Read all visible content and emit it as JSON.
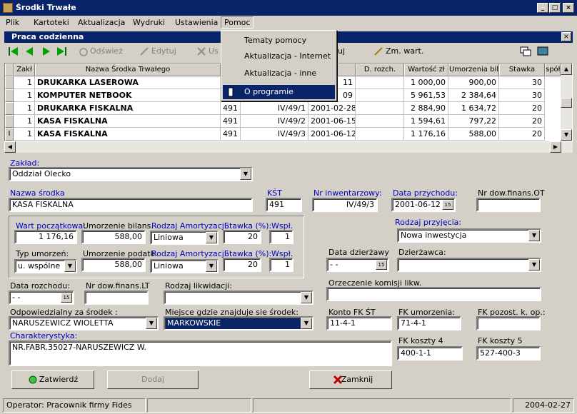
{
  "window": {
    "title": "Środki Trwałe",
    "min": "_",
    "max": "□",
    "close": "×"
  },
  "menu": [
    {
      "label": "Plik"
    },
    {
      "label": "Kartoteki"
    },
    {
      "label": "Aktualizacja"
    },
    {
      "label": "Wydruki"
    },
    {
      "label": "Ustawienia"
    },
    {
      "label": "Pomoc"
    }
  ],
  "dropdown": {
    "items": [
      {
        "label": "Tematy pomocy"
      },
      {
        "label": "Aktualizacja  - Internet"
      },
      {
        "label": "Aktualizacja  - inne"
      },
      {
        "label": "O programie"
      }
    ]
  },
  "inner": {
    "title": "Praca codzienna",
    "close": "×"
  },
  "toolbar": {
    "refresh": "Odśwież",
    "edit": "Edytuj",
    "delete": "Us",
    "hidden_fragment": "uj",
    "change_value": "Zm. wart."
  },
  "grid": {
    "headers": [
      "Zakł",
      "Nazwa Środka Trwałego",
      "",
      "",
      "ch.",
      "D. rozch.",
      "Wartość zł",
      "Umorzenia bil.",
      "Stawka",
      "spół"
    ],
    "rows": [
      {
        "zakl": "1",
        "name": "DRUKARKA LASEROWA",
        "kst": "",
        "inv": "",
        "date": "11",
        "rozch": "",
        "value": "1 000,00",
        "umorz": "900,00",
        "stawka": "30"
      },
      {
        "zakl": "1",
        "name": "KOMPUTER NETBOOK",
        "kst": "",
        "inv": "",
        "date": "09",
        "rozch": "",
        "value": "5 961,53",
        "umorz": "2 384,64",
        "stawka": "30"
      },
      {
        "zakl": "1",
        "name": "DRUKARKA FISKALNA",
        "kst": "491",
        "inv": "IV/49/1",
        "date": "2001-02-28",
        "rozch": "",
        "value": "2 884,90",
        "umorz": "1 634,72",
        "stawka": "20"
      },
      {
        "zakl": "1",
        "name": "KASA FISKALNA",
        "kst": "491",
        "inv": "IV/49/2",
        "date": "2001-06-15",
        "rozch": "",
        "value": "1 594,61",
        "umorz": "797,22",
        "stawka": "20"
      },
      {
        "zakl": "1",
        "name": "KASA FISKALNA",
        "kst": "491",
        "inv": "IV/49/3",
        "date": "2001-06-12",
        "rozch": "",
        "value": "1 176,16",
        "umorz": "588,00",
        "stawka": "20"
      }
    ],
    "current_marker": "I"
  },
  "form": {
    "zaklad_label": "Zakład:",
    "zaklad_value": "Oddział Olecko",
    "nazwa_label": "Nazwa środka",
    "nazwa_value": "KASA FISKALNA",
    "kst_label": "KŚT",
    "kst_value": "491",
    "nrinw_label": "Nr inwentarzowy:",
    "nrinw_value": "IV/49/3",
    "dataprzych_label": "Data przychodu:",
    "dataprzych_value": "2001-06-12",
    "cal_icon": "15",
    "nrdowot_label": "Nr dow.finans.OT",
    "nrdowot_value": "",
    "wartpocz_label": "Wart początkowa:",
    "wartpocz_value": "1 176,16",
    "umorzbil_label": "Umorzenie bilans.",
    "umorzbil_value": "588,00",
    "rodzam1_label": "Rodzaj Amortyzacji:",
    "rodzam1_value": "Liniowa",
    "stawka1_label": "Stawka (%):",
    "stawka1_value": "20",
    "wsp1_label": "Wspł.",
    "wsp1_value": "1",
    "typumorz_label": "Typ umorzeń:",
    "typumorz_value": "u. wspólne",
    "umorzpod_label": "Umorzenie podatk.",
    "umorzpod_value": "588,00",
    "rodzam2_label": "Rodzaj Amortyzacji:",
    "rodzam2_value": "Liniowa",
    "stawka2_label": "Stawka (%):",
    "stawka2_value": "20",
    "wsp2_label": "Wspł.",
    "wsp2_value": "1",
    "rodzprzyj_label": "Rodzaj przyjęcia:",
    "rodzprzyj_value": "Nowa inwestycja",
    "datadzierz_label": "Data dzierżawy",
    "datadzierz_value": " - -",
    "dzierzawca_label": "Dzierżawca:",
    "dzierzawca_value": "",
    "datarozch_label": "Data rozchodu:",
    "datarozch_value": " - -",
    "nrdowlt_label": "Nr dow.finans.LT",
    "nrdowlt_value": "",
    "rodzlikw_label": "Rodzaj likwidacji:",
    "rodzlikw_value": "",
    "orzecz_label": "Orzeczenie komisji likw.",
    "orzecz_value": "",
    "odpow_label": "Odpowiedzialny za środek :",
    "odpow_value": "NARUSZEWICZ WIOLETTA",
    "miejsce_label": "Miejsce gdzie znajduje sie środek:",
    "miejsce_value": "MARKOWSKIE",
    "kontofk_label": "Konto FK ŚT",
    "kontofk_value": "11-4-1",
    "fkumorz_label": "FK umorzenia:",
    "fkumorz_value": "71-4-1",
    "fkpozost_label": "FK pozost. k. op.:",
    "fkpozost_value": "",
    "charakt_label": "Charakterystyka:",
    "charakt_value": "NR.FABR.35027-NARUSZEWICZ W.",
    "fkkoszty4_label": "FK koszty 4",
    "fkkoszty4_value": "400-1-1",
    "fkkoszty5_label": "FK koszty 5",
    "fkkoszty5_value": "527-400-3"
  },
  "buttons": {
    "zatwierdz": "Zatwierdź",
    "dodaj": "Dodaj",
    "zamknij": "Zamknij"
  },
  "status": {
    "operator": "Operator: Pracownik firmy Fides",
    "date": "2004-02-27"
  }
}
